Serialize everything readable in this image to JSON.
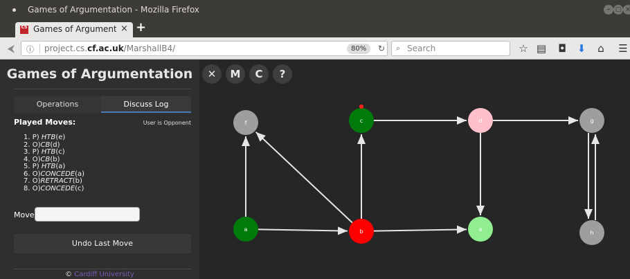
{
  "window": {
    "title": "Games of Argumentation - Mozilla Firefox"
  },
  "tab": {
    "favicon_text": "CS",
    "label": "Games of Argumentati",
    "close": "×"
  },
  "newtab": "+",
  "navbar": {
    "info_icon": "ⓘ",
    "url_prefix": "project.cs.",
    "url_domain": "cf.ac.uk",
    "url_suffix": "/MarshallB4/",
    "zoom": "80%",
    "search_placeholder": "Search"
  },
  "app": {
    "title": "Games of Argumentation",
    "tabs": [
      "Operations",
      "Discuss Log"
    ],
    "played_label": "Played Moves:",
    "role": "User is Opponent",
    "moves": [
      {
        "prefix": "1. P) ",
        "verb": "HTB",
        "arg": "(e)"
      },
      {
        "prefix": "2. O)",
        "verb": "CB",
        "arg": "(d)"
      },
      {
        "prefix": "3. P) ",
        "verb": "HTB",
        "arg": "(c)"
      },
      {
        "prefix": "4. O)",
        "verb": "CB",
        "arg": "(b)"
      },
      {
        "prefix": "5. P) ",
        "verb": "HTB",
        "arg": "(a)"
      },
      {
        "prefix": "6. O)",
        "verb": "CONCEDE",
        "arg": "(a)"
      },
      {
        "prefix": "7. O)",
        "verb": "RETRACT",
        "arg": "(b)"
      },
      {
        "prefix": "8. O)",
        "verb": "CONCEDE",
        "arg": "(c)"
      }
    ],
    "move_label": "Move:",
    "move_value": "",
    "undo_label": "Undo Last Move",
    "footer_prefix": "© ",
    "footer_link": "Cardiff University"
  },
  "canvas_buttons": [
    "✕",
    "M",
    "C",
    "?"
  ],
  "graph": {
    "nodes": [
      {
        "id": "f",
        "color": "#9e9e9e"
      },
      {
        "id": "c",
        "color": "#007a0b"
      },
      {
        "id": "d",
        "color": "#ffc0cb"
      },
      {
        "id": "g",
        "color": "#9e9e9e"
      },
      {
        "id": "a",
        "color": "#007a0b"
      },
      {
        "id": "b",
        "color": "#ff0000"
      },
      {
        "id": "e",
        "color": "#90ee90"
      },
      {
        "id": "h",
        "color": "#9e9e9e"
      }
    ],
    "edges": [
      [
        "a",
        "f"
      ],
      [
        "a",
        "b"
      ],
      [
        "b",
        "f"
      ],
      [
        "b",
        "c"
      ],
      [
        "b",
        "e"
      ],
      [
        "c",
        "d"
      ],
      [
        "d",
        "g"
      ],
      [
        "d",
        "e"
      ],
      [
        "g",
        "h"
      ],
      [
        "h",
        "g"
      ]
    ]
  }
}
